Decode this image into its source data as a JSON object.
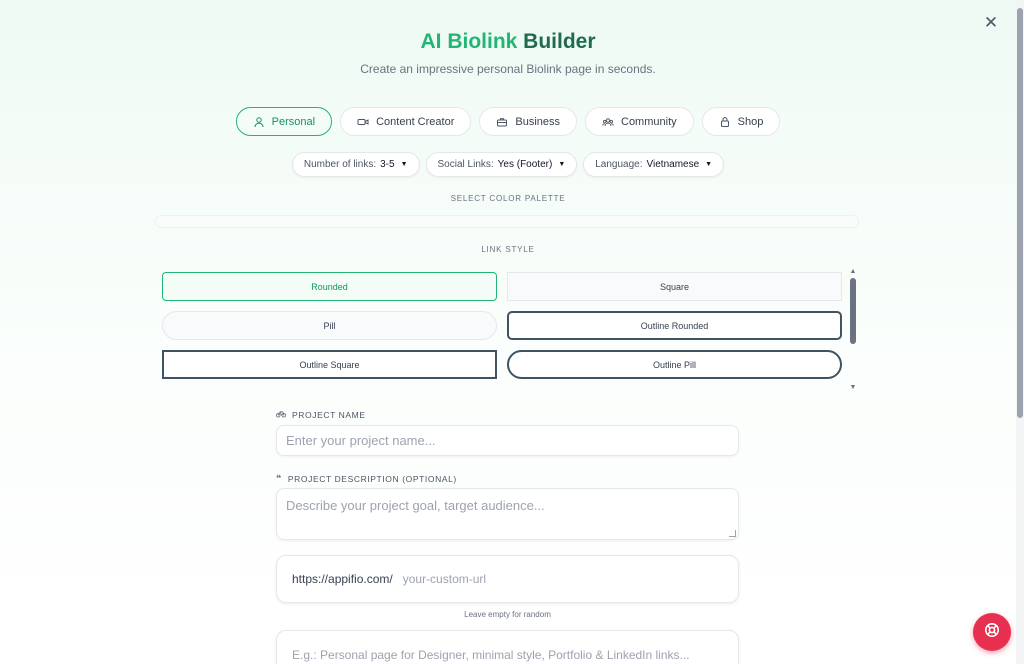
{
  "header": {
    "title_part1": "AI Biolink",
    "title_part2": "Builder",
    "subtitle": "Create an impressive personal Biolink page in seconds."
  },
  "tabs": [
    {
      "label": "Personal",
      "icon": "user-icon",
      "active": true
    },
    {
      "label": "Content Creator",
      "icon": "video-icon",
      "active": false
    },
    {
      "label": "Business",
      "icon": "briefcase-icon",
      "active": false
    },
    {
      "label": "Community",
      "icon": "group-icon",
      "active": false
    },
    {
      "label": "Shop",
      "icon": "lock-icon",
      "active": false
    }
  ],
  "filters": [
    {
      "label": "Number of links:",
      "value": "3-5"
    },
    {
      "label": "Social Links:",
      "value": "Yes (Footer)"
    },
    {
      "label": "Language:",
      "value": "Vietnamese"
    }
  ],
  "palette": {
    "label": "SELECT COLOR PALETTE"
  },
  "link_style": {
    "label": "LINK STYLE",
    "options": [
      "Rounded",
      "Square",
      "Pill",
      "Outline Rounded",
      "Outline Square",
      "Outline Pill"
    ],
    "selected": "Rounded"
  },
  "project_name": {
    "label": "PROJECT NAME",
    "placeholder": "Enter your project name..."
  },
  "project_description": {
    "label": "PROJECT DESCRIPTION (OPTIONAL)",
    "placeholder": "Describe your project goal, target audience..."
  },
  "url": {
    "prefix": "https://appifio.com/",
    "placeholder": "your-custom-url",
    "hint": "Leave empty for random"
  },
  "prompt": {
    "placeholder": "E.g.: Personal page for Designer, minimal style, Portfolio & LinkedIn links..."
  },
  "colors": {
    "accent": "#22b573",
    "title_dark": "#1f6b4d",
    "outline": "#3f5362",
    "help_fab": "#e7304f"
  }
}
